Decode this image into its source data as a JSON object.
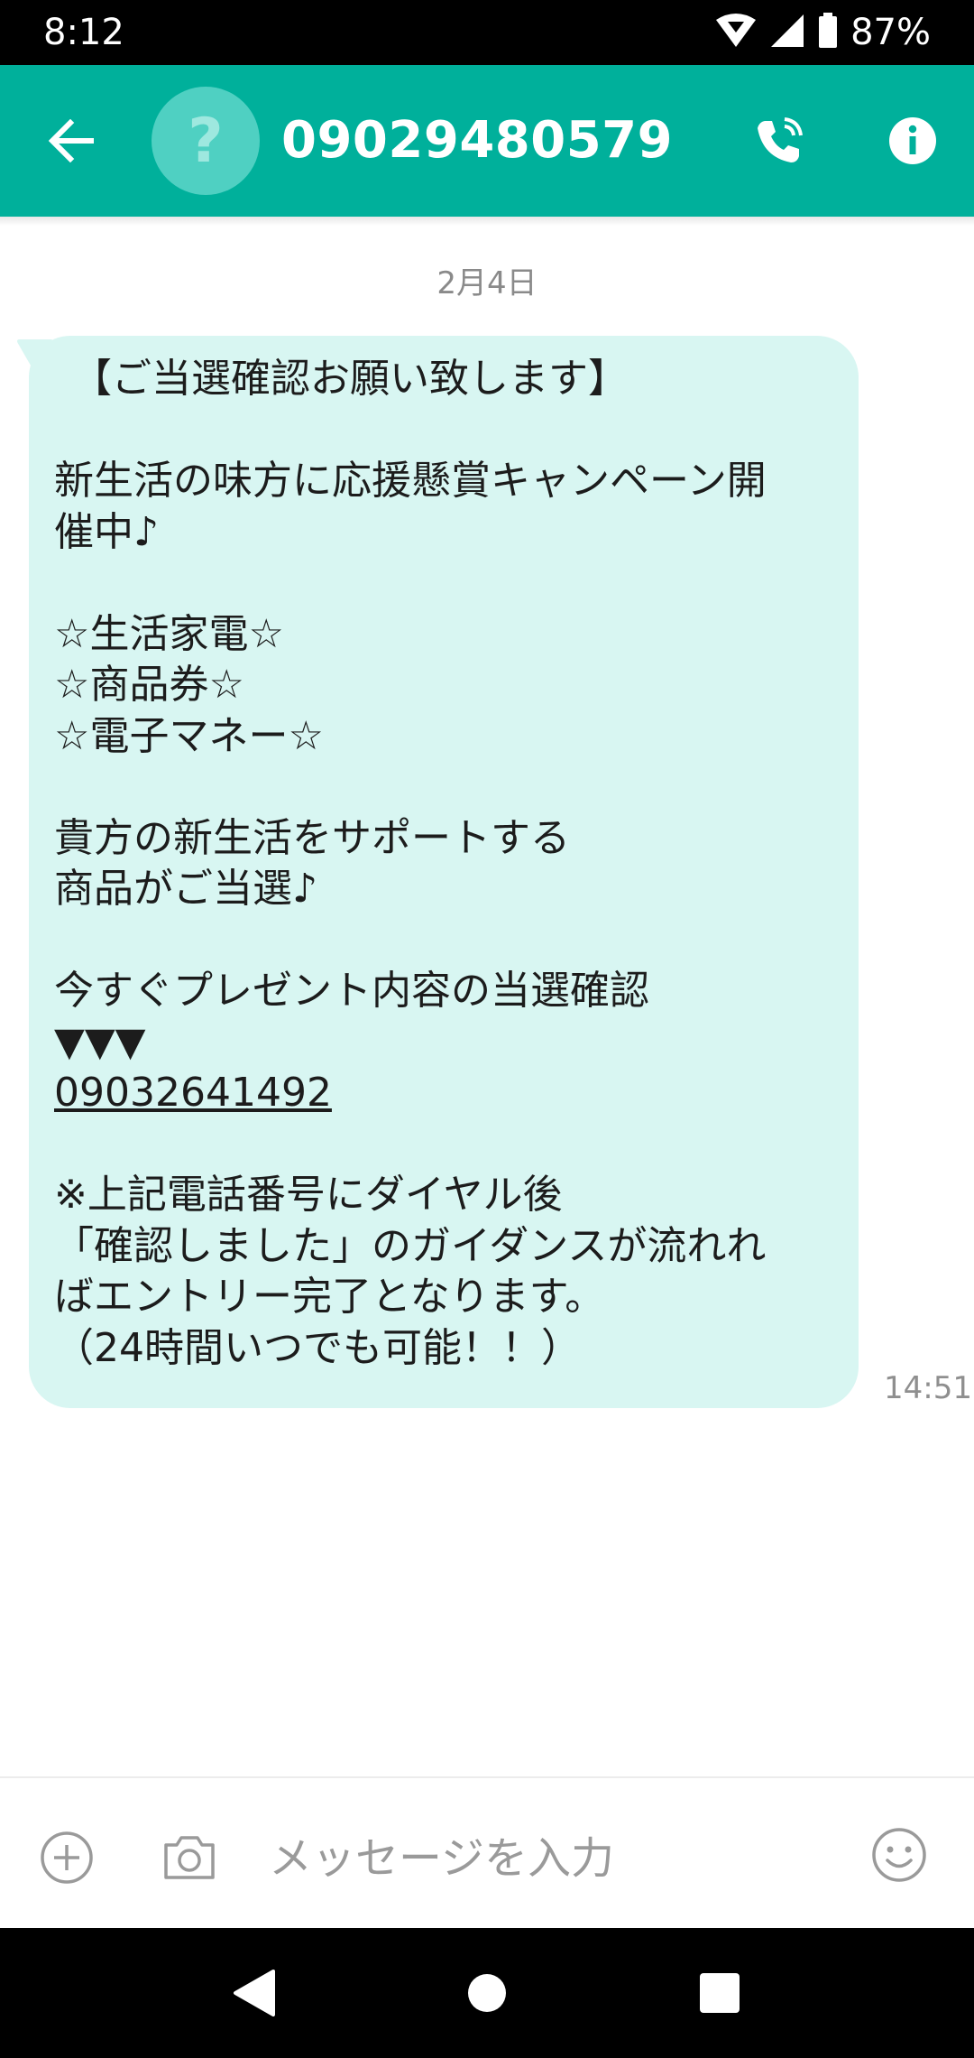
{
  "status_bar": {
    "time": "8:12",
    "battery": "87%",
    "icons": [
      "wifi-icon",
      "signal-icon",
      "battery-icon"
    ]
  },
  "app_bar": {
    "title": "09029480579",
    "avatar_glyph": "?",
    "icons": [
      "back-arrow-icon",
      "phone-call-icon",
      "info-icon"
    ],
    "color": "#00b09b"
  },
  "conversation": {
    "date": "2月4日",
    "message": {
      "time": "14:51",
      "lines": [
        "【ご当選確認お願い致します】",
        "",
        "新生活の味方に応援懸賞キャンペーン開",
        "催中♪",
        "",
        "☆生活家電☆",
        "☆商品券☆",
        "☆電子マネー☆",
        "",
        "貴方の新生活をサポートする",
        "商品がご当選♪",
        "",
        "今すぐプレゼント内容の当選確認",
        "▼▼▼",
        "09032641492",
        "",
        "※上記電話番号にダイヤル後",
        "「確認しました」のガイダンスが流れれ",
        "ばエントリー完了となります。",
        "（24時間いつでも可能！！）"
      ],
      "bubble_color": "#d8f6f2"
    }
  },
  "composer": {
    "placeholder": "メッセージを入力",
    "icons": [
      "add-icon",
      "camera-icon",
      "emoji-icon"
    ]
  },
  "nav_bar": {
    "icons": [
      "back-triangle-icon",
      "home-circle-icon",
      "recents-square-icon"
    ]
  }
}
